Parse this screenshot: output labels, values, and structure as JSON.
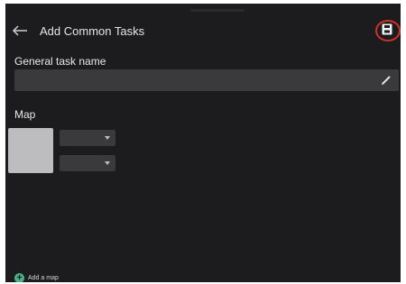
{
  "header": {
    "title": "Add Common Tasks",
    "back_icon": "arrow-left-icon",
    "save_icon": "save-icon"
  },
  "form": {
    "general_task_label": "General task name",
    "general_task_value": "",
    "edit_icon": "pencil-icon",
    "map_label": "Map"
  },
  "map_entry": {
    "dropdown_1_value": "",
    "dropdown_2_value": ""
  },
  "footer": {
    "add_map_label": "Add a map",
    "add_icon": "plus-circle-icon"
  },
  "colors": {
    "background": "#1c1c1e",
    "field": "#3a3a3c",
    "accent": "#4cae86",
    "highlight_ring": "#d0302c"
  }
}
